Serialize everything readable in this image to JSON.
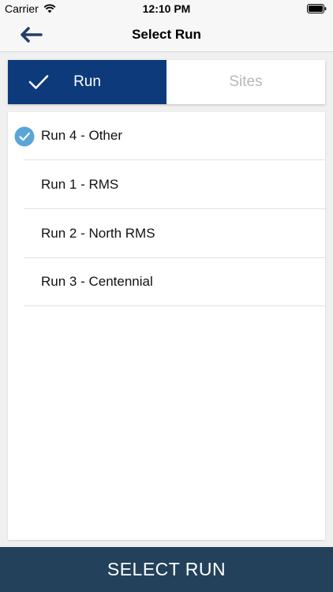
{
  "status_bar": {
    "carrier": "Carrier",
    "time": "12:10 PM"
  },
  "nav": {
    "title": "Select Run",
    "back_icon": "arrow-left-icon"
  },
  "tabs": [
    {
      "label": "Run",
      "selected": true
    },
    {
      "label": "Sites",
      "selected": false
    }
  ],
  "runs": [
    {
      "label": "Run 4 - Other",
      "selected": true
    },
    {
      "label": "Run 1 - RMS",
      "selected": false
    },
    {
      "label": "Run 2 - North RMS",
      "selected": false
    },
    {
      "label": "Run 3 - Centennial",
      "selected": false
    }
  ],
  "footer": {
    "select_label": "SELECT RUN"
  },
  "colors": {
    "tab_selected": "#0d3a7a",
    "check_blue": "#5aa5d8",
    "footer": "#23415a",
    "back_arrow": "#1f3f66"
  }
}
